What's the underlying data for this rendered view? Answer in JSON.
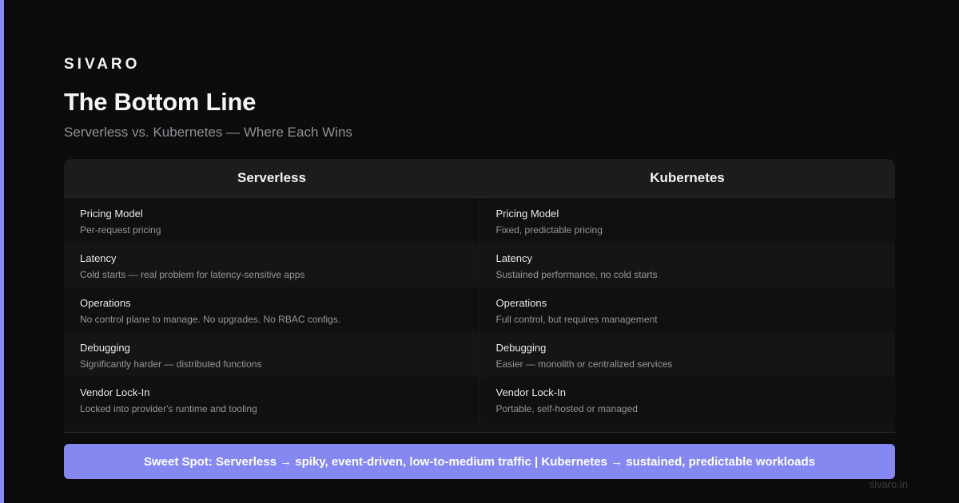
{
  "brand": "SIVARO",
  "title": "The Bottom Line",
  "subtitle": "Serverless vs. Kubernetes — Where Each Wins",
  "colors": {
    "background": "#0c0c0c",
    "accent": "#8b8cf5",
    "callout": "#8688f2"
  },
  "table": {
    "columns": [
      "Serverless",
      "Kubernetes"
    ],
    "rows": [
      {
        "serverless": {
          "label": "Pricing Model",
          "value": "Per-request pricing"
        },
        "kubernetes": {
          "label": "Pricing Model",
          "value": "Fixed, predictable pricing"
        }
      },
      {
        "serverless": {
          "label": "Latency",
          "value": "Cold starts — real problem for latency-sensitive apps"
        },
        "kubernetes": {
          "label": "Latency",
          "value": "Sustained performance, no cold starts"
        }
      },
      {
        "serverless": {
          "label": "Operations",
          "value": "No control plane to manage. No upgrades. No RBAC configs."
        },
        "kubernetes": {
          "label": "Operations",
          "value": "Full control, but requires management"
        }
      },
      {
        "serverless": {
          "label": "Debugging",
          "value": "Significantly harder — distributed functions"
        },
        "kubernetes": {
          "label": "Debugging",
          "value": "Easier — monolith or centralized services"
        }
      },
      {
        "serverless": {
          "label": "Vendor Lock-In",
          "value": "Locked into provider's runtime and tooling"
        },
        "kubernetes": {
          "label": "Vendor Lock-In",
          "value": "Portable, self-hosted or managed"
        }
      }
    ]
  },
  "callout": "Sweet Spot: Serverless → spiky, event-driven, low-to-medium traffic | Kubernetes → sustained, predictable workloads",
  "footer": "sivaro.in"
}
